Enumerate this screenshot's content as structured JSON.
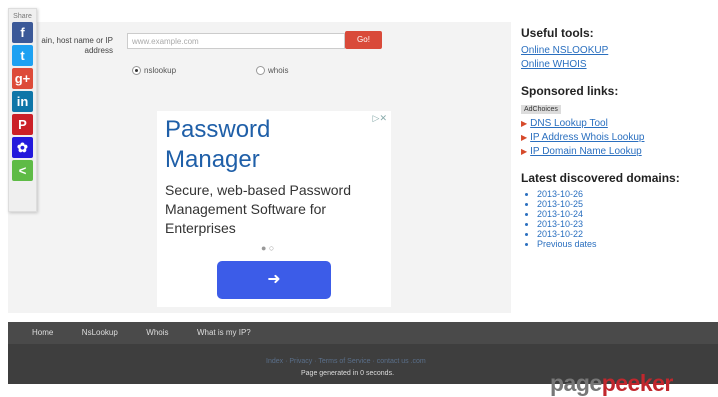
{
  "share": {
    "label": "Share",
    "buttons": [
      {
        "name": "facebook",
        "glyph": "f",
        "color": "#3b5998"
      },
      {
        "name": "twitter",
        "glyph": "t",
        "color": "#1da1f2"
      },
      {
        "name": "googleplus",
        "glyph": "g+",
        "color": "#dd4b39"
      },
      {
        "name": "linkedin",
        "glyph": "in",
        "color": "#0e76a8"
      },
      {
        "name": "pinterest",
        "glyph": "P",
        "color": "#cb2027"
      },
      {
        "name": "baidu",
        "glyph": "✿",
        "color": "#2319dc"
      },
      {
        "name": "sharethis",
        "glyph": "<",
        "color": "#5ebb46"
      }
    ]
  },
  "form": {
    "label": "ain, host name or IP address",
    "placeholder": "www.example.com",
    "go": "Go!",
    "radio1": "nslookup",
    "radio2": "whois"
  },
  "ad": {
    "title": "Password Manager",
    "body": "Secure, web-based Password Management Software for Enterprises",
    "dots": "● ○",
    "button": "➜"
  },
  "right": {
    "useful_title": "Useful tools:",
    "useful_links": [
      "Online NSLOOKUP",
      "Online WHOIS"
    ],
    "sponsored_title": "Sponsored links:",
    "adchoices": "AdChoices",
    "sponsored_links": [
      "DNS Lookup Tool",
      "IP Address Whois Lookup",
      "IP Domain Name Lookup"
    ],
    "latest_title": "Latest discovered domains:",
    "dates": [
      "2013-10-26",
      "2013-10-25",
      "2013-10-24",
      "2013-10-23",
      "2013-10-22",
      "Previous dates"
    ]
  },
  "nav": [
    "Home",
    "NsLookup",
    "Whois",
    "What is my IP?"
  ],
  "footer": {
    "links": "Index · Privacy · Terms of Service · contact us .com",
    "generated": "Page generated in 0 seconds."
  },
  "watermark": {
    "a": "page",
    "b": "peeker"
  }
}
